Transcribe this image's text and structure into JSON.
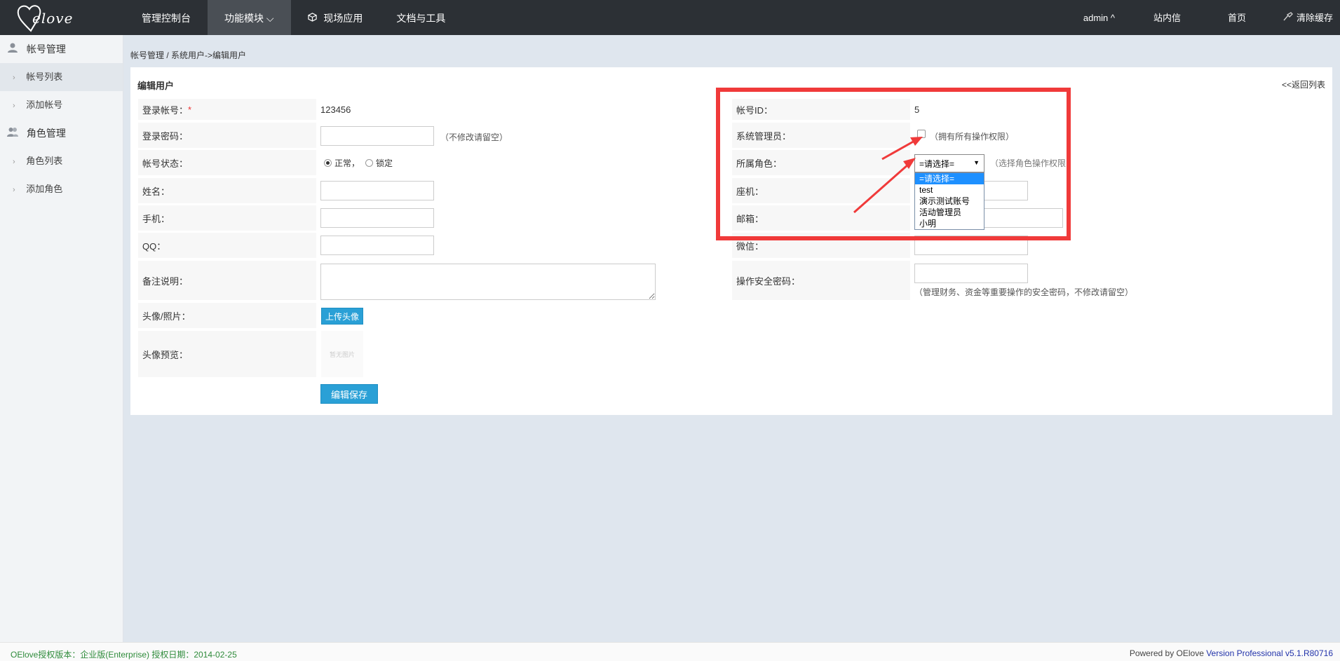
{
  "header": {
    "logo_text": "elove",
    "nav": [
      {
        "label": "管理控制台"
      },
      {
        "label": "功能模块 ",
        "chevron": "⌵"
      },
      {
        "label": "现场应用",
        "icon": "cube-icon"
      },
      {
        "label": "文档与工具"
      }
    ],
    "right": {
      "user": "admin ^",
      "messages": "站内信",
      "home": "首页",
      "clear_cache": "清除缓存"
    }
  },
  "sidebar": {
    "groups": [
      {
        "label": "帐号管理",
        "icon": "user-icon",
        "items": [
          "帐号列表",
          "添加帐号"
        ]
      },
      {
        "label": "角色管理",
        "icon": "users-icon",
        "items": [
          "角色列表",
          "添加角色"
        ]
      }
    ]
  },
  "breadcrumb": "帐号管理 / 系统用户->编辑用户",
  "panel": {
    "title": "编辑用户",
    "back": "<<返回列表",
    "left": {
      "login_account_label": "登录帐号：",
      "login_account_required": "*",
      "login_account_value": "123456",
      "password_label": "登录密码：",
      "password_hint": "（不修改请留空）",
      "status_label": "帐号状态：",
      "status_normal": "正常，",
      "status_locked": "锁定",
      "status_selected": "normal",
      "name_label": "姓名：",
      "mobile_label": "手机：",
      "qq_label": "QQ：",
      "remark_label": "备注说明：",
      "photo_label": "头像/照片：",
      "upload_button": "上传头像",
      "preview_label": "头像预览：",
      "preview_placeholder": "暂无图片",
      "save_button": "编辑保存"
    },
    "right": {
      "account_id_label": "帐号ID：",
      "account_id_value": "5",
      "sysadmin_label": "系统管理员：",
      "sysadmin_hint": "（拥有所有操作权限）",
      "role_label": "所属角色：",
      "role_selected": "=请选择=",
      "role_hint": "（选择角色操作权限",
      "role_options": [
        "=请选择=",
        "test",
        "演示测试账号",
        "活动管理员",
        "小明"
      ],
      "phone_label": "座机：",
      "email_label": "邮箱：",
      "wechat_label": "微信：",
      "security_label": "操作安全密码：",
      "security_hint": "（管理财务、资金等重要操作的安全密码，不修改请留空）"
    }
  },
  "footer": {
    "left": "OElove授权版本：企业版(Enterprise) 授权日期：2014-02-25",
    "right_prefix": "Powered by OElove ",
    "right_version": "Version Professional v5.1.R80716"
  },
  "colors": {
    "topbar": "#2c3035",
    "accent": "#2aa0d6",
    "annotation": "#f03a3a",
    "footer_green": "#2e8b3a"
  }
}
